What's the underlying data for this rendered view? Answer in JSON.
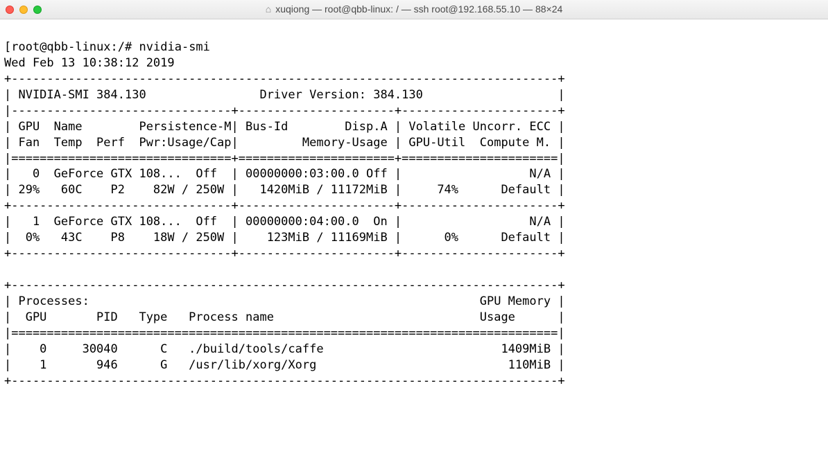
{
  "window": {
    "title": "xuqiong — root@qbb-linux: / — ssh root@192.168.55.10 — 88×24"
  },
  "prompt": {
    "open_bracket": "[",
    "user_host": "root@qbb-linux",
    "path_sep": ":",
    "path": "/",
    "close_suffix": "#",
    "command": "nvidia-smi"
  },
  "timestamp": "Wed Feb 13 10:38:12 2019",
  "smi": {
    "top_line": "+-----------------------------------------------------------------------------+",
    "version_line": "| NVIDIA-SMI 384.130                Driver Version: 384.130                   |",
    "thin_sep": "|-------------------------------+----------------------+----------------------+",
    "hdr1": "| GPU  Name        Persistence-M| Bus-Id        Disp.A | Volatile Uncorr. ECC |",
    "hdr2": "| Fan  Temp  Perf  Pwr:Usage/Cap|         Memory-Usage | GPU-Util  Compute M. |",
    "eq_sep": "|===============================+======================+======================|",
    "gpu0_l1": "|   0  GeForce GTX 108...  Off  | 00000000:03:00.0 Off |                  N/A |",
    "gpu0_l2": "| 29%   60C    P2    82W / 250W |   1420MiB / 11172MiB |     74%      Default |",
    "mid_sep": "+-------------------------------+----------------------+----------------------+",
    "gpu1_l1": "|   1  GeForce GTX 108...  Off  | 00000000:04:00.0  On |                  N/A |",
    "gpu1_l2": "|  0%   43C    P8    18W / 250W |    123MiB / 11169MiB |      0%      Default |",
    "bottom_sep": "+-------------------------------+----------------------+----------------------+",
    "blank": "                                                                               ",
    "proc_top": "+-----------------------------------------------------------------------------+",
    "proc_h1": "| Processes:                                                       GPU Memory |",
    "proc_h2": "|  GPU       PID   Type   Process name                             Usage      |",
    "proc_eq": "|=============================================================================|",
    "proc_r1": "|    0     30040      C   ./build/tools/caffe                         1409MiB |",
    "proc_r2": "|    1       946      G   /usr/lib/xorg/Xorg                           110MiB |",
    "proc_bot": "+-----------------------------------------------------------------------------+"
  },
  "chart_data": {
    "type": "table",
    "title": "nvidia-smi",
    "driver_version": "384.130",
    "smi_version": "384.130",
    "timestamp": "Wed Feb 13 10:38:12 2019",
    "gpus": [
      {
        "index": 0,
        "name": "GeForce GTX 108...",
        "persistence_m": "Off",
        "bus_id": "00000000:03:00.0",
        "disp_a": "Off",
        "ecc": "N/A",
        "fan_pct": 29,
        "temp_c": 60,
        "perf_state": "P2",
        "power_w": 82,
        "power_cap_w": 250,
        "mem_used_mib": 1420,
        "mem_total_mib": 11172,
        "gpu_util_pct": 74,
        "compute_mode": "Default"
      },
      {
        "index": 1,
        "name": "GeForce GTX 108...",
        "persistence_m": "Off",
        "bus_id": "00000000:04:00.0",
        "disp_a": "On",
        "ecc": "N/A",
        "fan_pct": 0,
        "temp_c": 43,
        "perf_state": "P8",
        "power_w": 18,
        "power_cap_w": 250,
        "mem_used_mib": 123,
        "mem_total_mib": 11169,
        "gpu_util_pct": 0,
        "compute_mode": "Default"
      }
    ],
    "processes": [
      {
        "gpu": 0,
        "pid": 30040,
        "type": "C",
        "process_name": "./build/tools/caffe",
        "gpu_memory_mib": 1409
      },
      {
        "gpu": 1,
        "pid": 946,
        "type": "G",
        "process_name": "/usr/lib/xorg/Xorg",
        "gpu_memory_mib": 110
      }
    ]
  }
}
